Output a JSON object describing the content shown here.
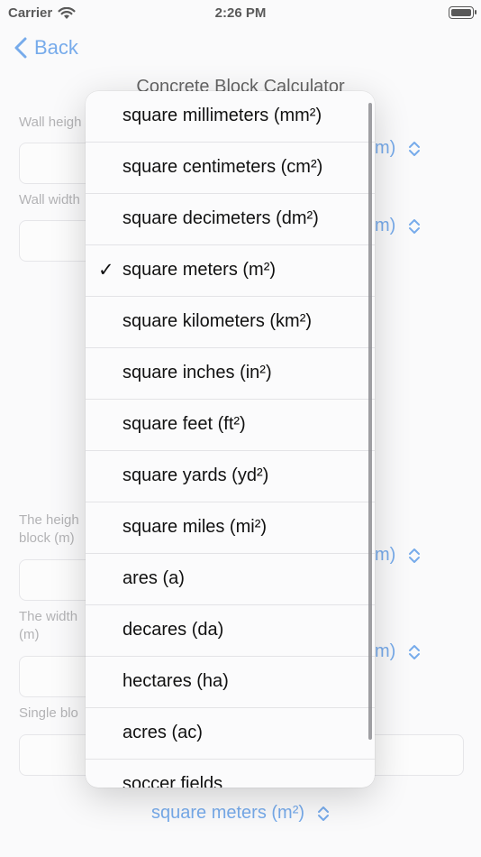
{
  "status_bar": {
    "carrier": "Carrier",
    "time": "2:26 PM"
  },
  "nav": {
    "back_label": "Back",
    "title": "Concrete Block Calculator"
  },
  "form": {
    "wall_height_label": "Wall heigh",
    "wall_width_label": "Wall width",
    "block_height_label_line1": "The heigh",
    "block_height_label_line2": "block (m)",
    "block_width_label_line1": "The width",
    "block_width_label_line2": "(m)",
    "single_block_label": "Single blo",
    "unit_tail": "m)"
  },
  "bottom_picker": {
    "selected": "square meters (m²)"
  },
  "menu": {
    "items": [
      {
        "label": "square millimeters (mm²)",
        "checked": false
      },
      {
        "label": "square centimeters (cm²)",
        "checked": false
      },
      {
        "label": "square decimeters (dm²)",
        "checked": false
      },
      {
        "label": "square meters (m²)",
        "checked": true
      },
      {
        "label": "square kilometers (km²)",
        "checked": false
      },
      {
        "label": "square inches (in²)",
        "checked": false
      },
      {
        "label": "square feet (ft²)",
        "checked": false
      },
      {
        "label": "square yards (yd²)",
        "checked": false
      },
      {
        "label": "square miles (mi²)",
        "checked": false
      },
      {
        "label": "ares (a)",
        "checked": false
      },
      {
        "label": "decares (da)",
        "checked": false
      },
      {
        "label": "hectares (ha)",
        "checked": false
      },
      {
        "label": "acres (ac)",
        "checked": false
      },
      {
        "label": "soccer fields",
        "checked": false
      }
    ],
    "checkmark": "✓"
  },
  "colors": {
    "accent": "#2f7fe0",
    "background": "#f7f7f9",
    "menu_bg": "#fbfbfc"
  }
}
